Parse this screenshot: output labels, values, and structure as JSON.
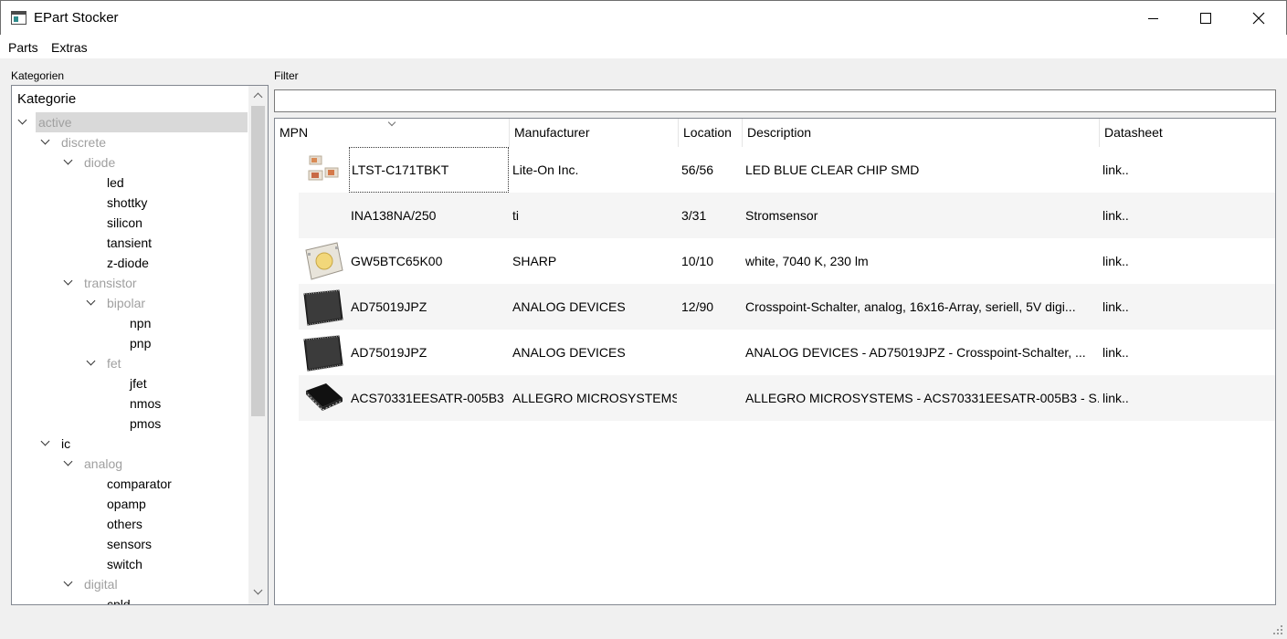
{
  "window": {
    "title": "EPart Stocker"
  },
  "menu": {
    "parts": "Parts",
    "extras": "Extras"
  },
  "categories": {
    "group_label": "Kategorien",
    "header": "Kategorie",
    "tree": [
      {
        "label": "active",
        "expanded": true
      },
      {
        "label": "discrete",
        "expanded": true
      },
      {
        "label": "diode",
        "expanded": true
      },
      {
        "label": "led"
      },
      {
        "label": "shottky"
      },
      {
        "label": "silicon"
      },
      {
        "label": "tansient"
      },
      {
        "label": "z-diode"
      },
      {
        "label": "transistor",
        "expanded": true
      },
      {
        "label": "bipolar",
        "expanded": true
      },
      {
        "label": "npn"
      },
      {
        "label": "pnp"
      },
      {
        "label": "fet",
        "expanded": true
      },
      {
        "label": "jfet"
      },
      {
        "label": "nmos"
      },
      {
        "label": "pmos"
      },
      {
        "label": "ic",
        "expanded": true
      },
      {
        "label": "analog",
        "expanded": true
      },
      {
        "label": "comparator"
      },
      {
        "label": "opamp"
      },
      {
        "label": "others"
      },
      {
        "label": "sensors"
      },
      {
        "label": "switch"
      },
      {
        "label": "digital",
        "expanded": true
      },
      {
        "label": "cpld"
      }
    ]
  },
  "filter": {
    "label": "Filter",
    "value": ""
  },
  "table": {
    "columns": [
      "MPN",
      "Manufacturer",
      "Location",
      "Description",
      "Datasheet"
    ],
    "sort_column": "MPN",
    "rows": [
      {
        "image": "led-chip-thumbnail",
        "mpn": "LTST-C171TBKT",
        "manufacturer": "Lite-On Inc.",
        "location": "56/56",
        "description": "LED BLUE CLEAR CHIP SMD",
        "datasheet": "link.."
      },
      {
        "image": "",
        "mpn": "INA138NA/250",
        "manufacturer": "ti",
        "location": "3/31",
        "description": "Stromsensor",
        "datasheet": "link.."
      },
      {
        "image": "cob-led-thumbnail",
        "mpn": "GW5BTC65K00",
        "manufacturer": "SHARP",
        "location": "10/10",
        "description": "white, 7040 K, 230 lm",
        "datasheet": "link.."
      },
      {
        "image": "plcc-ic-thumbnail",
        "mpn": "AD75019JPZ",
        "manufacturer": "ANALOG DEVICES",
        "location": "12/90",
        "description": "Crosspoint-Schalter, analog, 16x16-Array, seriell, 5V digi...",
        "datasheet": "link.."
      },
      {
        "image": "plcc-ic-thumbnail",
        "mpn": "AD75019JPZ",
        "manufacturer": "ANALOG DEVICES",
        "location": "",
        "description": "ANALOG DEVICES - AD75019JPZ - Crosspoint-Schalter, ...",
        "datasheet": "link.."
      },
      {
        "image": "qfn-ic-thumbnail",
        "mpn": "ACS70331EESATR-005B3",
        "manufacturer": "ALLEGRO MICROSYSTEMS",
        "location": "",
        "description": "ALLEGRO MICROSYSTEMS - ACS70331EESATR-005B3 - S...",
        "datasheet": "link.."
      }
    ]
  }
}
